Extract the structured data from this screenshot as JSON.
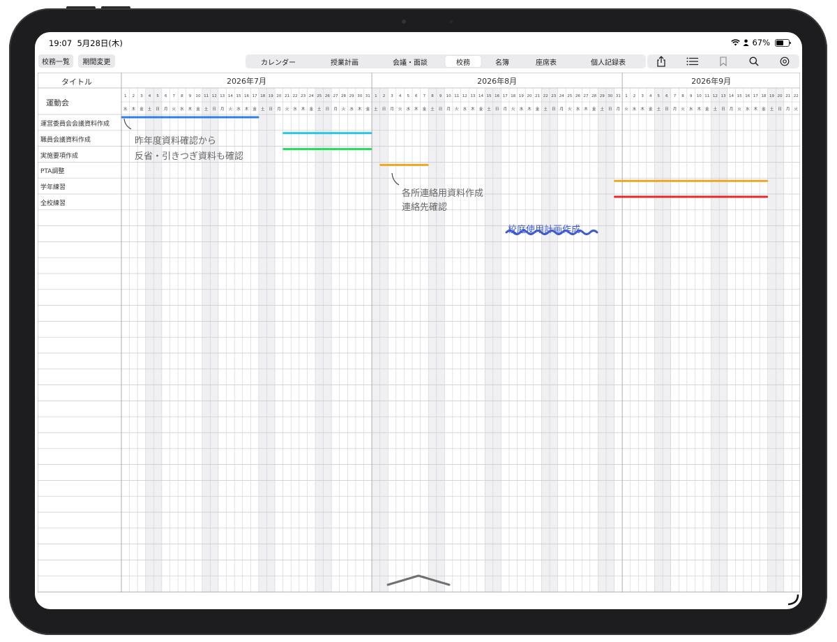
{
  "status": {
    "time": "19:07",
    "date": "5月28日(木)",
    "battery": "67%",
    "battery_level": 0.67
  },
  "toolbar": {
    "left_buttons": [
      "校務一覧",
      "期間変更"
    ],
    "segments": [
      "カレンダー",
      "授業計画",
      "会議・面談",
      "校務",
      "名簿",
      "座席表",
      "個人記録表"
    ],
    "active_segment": "校務",
    "right_icons": [
      "share-icon",
      "list-icon",
      "bookmark-icon",
      "search-icon",
      "settings-icon"
    ]
  },
  "chart_data": {
    "type": "gantt",
    "title_column": "タイトル",
    "project": "運動会",
    "months": [
      {
        "label": "2026年7月",
        "days": 31,
        "start_weekday": "水"
      },
      {
        "label": "2026年8月",
        "days": 31,
        "start_weekday": "土"
      },
      {
        "label": "2026年9月",
        "days": 22,
        "start_weekday": "火"
      }
    ],
    "weekdays": [
      "日",
      "月",
      "火",
      "水",
      "木",
      "金",
      "土"
    ],
    "tasks": [
      {
        "name": "運営委員会会議資料作成",
        "start": "2026-07-01",
        "end": "2026-07-17",
        "color": "#2f7fe6"
      },
      {
        "name": "職員会議資料作成",
        "start": "2026-07-21",
        "end": "2026-07-31",
        "color": "#22c5e6"
      },
      {
        "name": "実施要項作成",
        "start": "2026-07-21",
        "end": "2026-07-31",
        "color": "#22dd5a"
      },
      {
        "name": "PTA調整",
        "start": "2026-08-02",
        "end": "2026-08-07",
        "color": "#f0a422"
      },
      {
        "name": "学年練習",
        "start": "2026-08-31",
        "end": "2026-09-18",
        "color": "#f0a422"
      },
      {
        "name": "全校練習",
        "start": "2026-08-31",
        "end": "2026-09-18",
        "color": "#e62a2a"
      }
    ]
  },
  "handwriting": {
    "note1_line1": "昨年度資料確認から",
    "note1_line2": "反省・引きつぎ資料も確認",
    "note2_line1": "各所連絡用資料作成",
    "note2_line2": "連絡先確認",
    "note3": "校庭使用計画作成"
  }
}
